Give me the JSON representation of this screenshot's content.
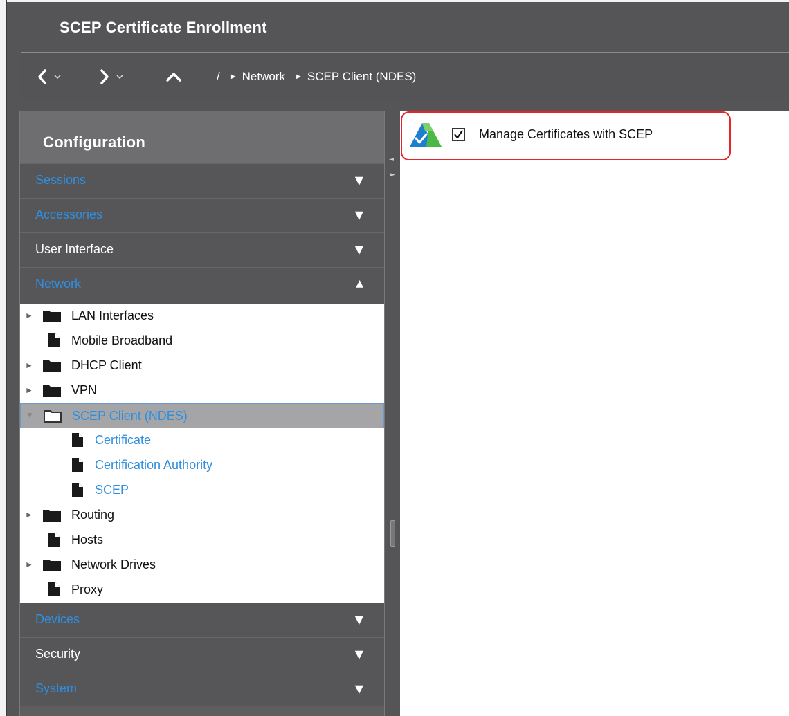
{
  "window": {
    "title": "SCEP Certificate Enrollment"
  },
  "nav": {
    "breadcrumb_root": "/",
    "breadcrumbs": [
      "Network",
      "SCEP Client (NDES)"
    ]
  },
  "sidebar": {
    "header": "Configuration",
    "sections_top": [
      {
        "label": "Sessions",
        "active": false,
        "expanded": false
      },
      {
        "label": "Accessories",
        "active": false,
        "expanded": false
      },
      {
        "label": "User Interface",
        "active": true,
        "expanded": false
      },
      {
        "label": "Network",
        "active": false,
        "expanded": true
      }
    ],
    "tree": [
      {
        "label": "LAN Interfaces",
        "type": "folder",
        "expandable": true
      },
      {
        "label": "Mobile Broadband",
        "type": "file",
        "expandable": false
      },
      {
        "label": "DHCP Client",
        "type": "folder",
        "expandable": true
      },
      {
        "label": "VPN",
        "type": "folder",
        "expandable": true
      },
      {
        "label": "SCEP Client (NDES)",
        "type": "folder-open",
        "expandable": true,
        "selected": true
      },
      {
        "label": "Certificate",
        "type": "file",
        "child": true
      },
      {
        "label": "Certification Authority",
        "type": "file",
        "child": true
      },
      {
        "label": "SCEP",
        "type": "file",
        "child": true
      },
      {
        "label": "Routing",
        "type": "folder",
        "expandable": true
      },
      {
        "label": "Hosts",
        "type": "file",
        "expandable": false
      },
      {
        "label": "Network Drives",
        "type": "folder",
        "expandable": true
      },
      {
        "label": "Proxy",
        "type": "file",
        "expandable": false
      }
    ],
    "sections_bottom": [
      {
        "label": "Devices",
        "active": false,
        "expanded": false
      },
      {
        "label": "Security",
        "active": true,
        "expanded": false
      },
      {
        "label": "System",
        "active": false,
        "expanded": false
      }
    ]
  },
  "content": {
    "checkbox_label": "Manage Certificates with SCEP",
    "checkbox_checked": true
  },
  "colors": {
    "highlight": "#e8232a",
    "link": "#2f8fde"
  },
  "icons": {
    "collapsed": "▼",
    "expanded": "▲",
    "tree_expand": "►"
  }
}
